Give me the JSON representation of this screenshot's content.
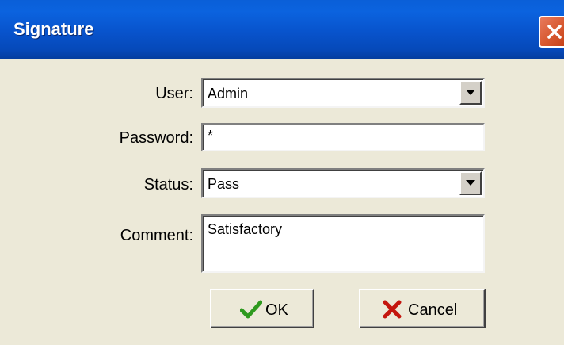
{
  "window": {
    "title": "Signature"
  },
  "icons": {
    "close": "close-icon",
    "dropdown": "chevron-down-icon",
    "ok": "checkmark-icon",
    "cancel": "cross-icon"
  },
  "colors": {
    "titlebar": "#0853cc",
    "close": "#d85a32",
    "ok_check": "#2e9a1e",
    "cancel_x": "#c4160e",
    "dialog_bg": "#ece9d8"
  },
  "form": {
    "user": {
      "label": "User:",
      "value": "Admin"
    },
    "password": {
      "label": "Password:",
      "value": "*"
    },
    "status": {
      "label": "Status:",
      "value": "Pass"
    },
    "comment": {
      "label": "Comment:",
      "value": "Satisfactory"
    }
  },
  "buttons": {
    "ok_label": "OK",
    "cancel_label": "Cancel"
  }
}
